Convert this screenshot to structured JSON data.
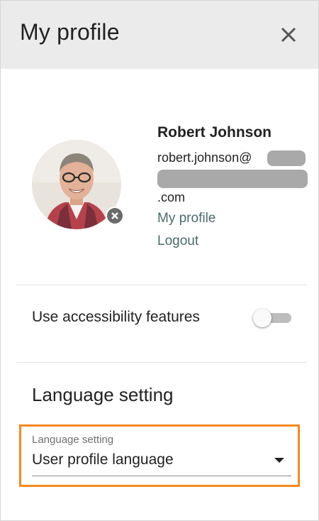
{
  "header": {
    "title": "My profile"
  },
  "user": {
    "name": "Robert Johnson",
    "email_prefix": "robert.johnson@",
    "email_suffix": ".com"
  },
  "links": {
    "my_profile": "My profile",
    "logout": "Logout"
  },
  "accessibility": {
    "label": "Use accessibility features",
    "enabled": false
  },
  "language": {
    "section_title": "Language setting",
    "field_label": "Language setting",
    "selected_value": "User profile language"
  },
  "colors": {
    "highlight": "#f5891f",
    "link": "#4b6b6b",
    "header_bg": "#ebebeb"
  }
}
